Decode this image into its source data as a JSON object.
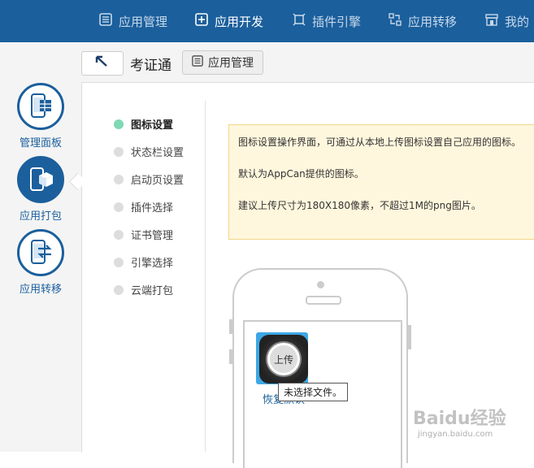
{
  "colors": {
    "brand": "#1b5f9c",
    "active_step": "#7ed8b4",
    "notice_bg": "#fff7dd",
    "notice_border": "#f0d58a",
    "icon_selection": "#3da7e6"
  },
  "topnav": {
    "items": [
      {
        "label": "应用管理",
        "icon": "list-icon",
        "active": false
      },
      {
        "label": "应用开发",
        "icon": "plus-square-icon",
        "active": true
      },
      {
        "label": "插件引擎",
        "icon": "frame-icon",
        "active": false
      },
      {
        "label": "应用转移",
        "icon": "transfer-icon",
        "active": false
      },
      {
        "label": "我的",
        "icon": "store-icon",
        "active": false
      }
    ]
  },
  "sidebar": {
    "items": [
      {
        "label": "管理面板",
        "icon": "phone-grid-icon",
        "active": false
      },
      {
        "label": "应用打包",
        "icon": "phone-box-icon",
        "active": true
      },
      {
        "label": "应用转移",
        "icon": "phone-transfer-icon",
        "active": false
      }
    ]
  },
  "header": {
    "back_icon": "back-arrow-icon",
    "app_name": "考证通",
    "tag_label": "应用管理",
    "tag_icon": "list-icon"
  },
  "steps": [
    {
      "label": "图标设置",
      "active": true
    },
    {
      "label": "状态栏设置",
      "active": false
    },
    {
      "label": "启动页设置",
      "active": false
    },
    {
      "label": "插件选择",
      "active": false
    },
    {
      "label": "证书管理",
      "active": false
    },
    {
      "label": "引擎选择",
      "active": false
    },
    {
      "label": "云端打包",
      "active": false
    }
  ],
  "notice": {
    "lines": [
      "图标设置操作界面，可通过从本地上传图标设置自己应用的图标。",
      "默认为AppCan提供的图标。",
      "建议上传尺寸为180X180像素，不超过1M的png图片。"
    ]
  },
  "preview": {
    "upload_label": "上传",
    "restore_label": "恢复默认",
    "file_tooltip": "未选择文件。"
  },
  "watermark": {
    "logo": "Baidu经验",
    "sub": "jingyan.baidu.com"
  }
}
